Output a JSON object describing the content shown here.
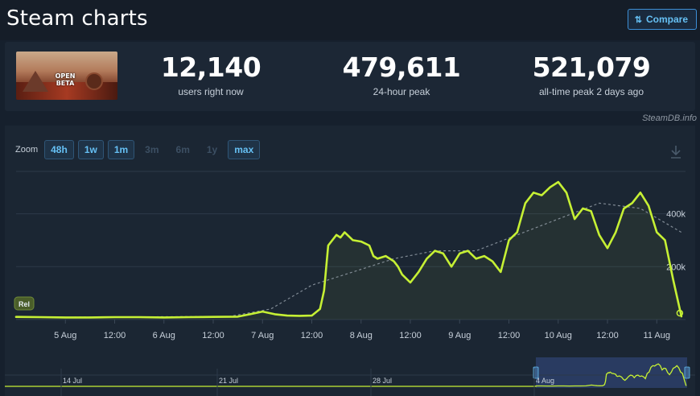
{
  "header": {
    "title": "Steam charts",
    "compare_label": "Compare"
  },
  "thumbnail": {
    "text": "OPEN BETA"
  },
  "stats": [
    {
      "value": "12,140",
      "label": "users right now"
    },
    {
      "value": "479,611",
      "label": "24-hour peak"
    },
    {
      "value": "521,079",
      "label": "all-time peak 2 days ago"
    }
  ],
  "attribution": "SteamDB.info",
  "zoom": {
    "label": "Zoom",
    "options": [
      {
        "label": "48h",
        "enabled": true
      },
      {
        "label": "1w",
        "enabled": true
      },
      {
        "label": "1m",
        "enabled": true
      },
      {
        "label": "3m",
        "enabled": false
      },
      {
        "label": "6m",
        "enabled": false
      },
      {
        "label": "1y",
        "enabled": false
      },
      {
        "label": "max",
        "enabled": true
      }
    ]
  },
  "colors": {
    "line": "#c6f034",
    "trend": "#9aa4ae",
    "grid": "#2c3949",
    "accent": "#66c0f4"
  },
  "chart_data": {
    "type": "line",
    "title": "",
    "xlabel": "",
    "ylabel": "",
    "x_ticks": [
      "5 Aug",
      "12:00",
      "6 Aug",
      "12:00",
      "7 Aug",
      "12:00",
      "8 Aug",
      "12:00",
      "9 Aug",
      "12:00",
      "10 Aug",
      "12:00",
      "11 Aug"
    ],
    "y_ticks": [
      {
        "value": 200000,
        "label": "200k"
      },
      {
        "value": 400000,
        "label": "400k"
      }
    ],
    "ylim": [
      0,
      560000
    ],
    "xlim_hours": [
      -12,
      151
    ],
    "grid": true,
    "release_label": "Rel",
    "series": [
      {
        "hours": [
          -12,
          -6,
          0,
          6,
          12,
          18,
          24,
          30,
          36,
          42,
          45,
          48,
          51,
          54,
          57,
          60,
          62,
          63,
          64,
          66,
          67,
          68,
          70,
          72,
          74,
          75,
          76,
          78,
          80,
          81,
          82,
          84,
          86,
          88,
          90,
          92,
          94,
          96,
          98,
          100,
          102,
          104,
          106,
          108,
          110,
          112,
          114,
          116,
          118,
          120,
          122,
          124,
          126,
          128,
          130,
          132,
          134,
          136,
          138,
          140,
          142,
          144,
          146,
          148,
          150
        ],
        "values": [
          10000,
          9000,
          8000,
          8000,
          9000,
          9000,
          8000,
          9000,
          10000,
          11000,
          20000,
          30000,
          20000,
          15000,
          14000,
          15000,
          40000,
          110000,
          280000,
          320000,
          310000,
          330000,
          300000,
          295000,
          280000,
          240000,
          230000,
          240000,
          220000,
          200000,
          170000,
          140000,
          180000,
          230000,
          260000,
          250000,
          200000,
          250000,
          260000,
          230000,
          240000,
          220000,
          180000,
          300000,
          330000,
          440000,
          480000,
          470000,
          500000,
          520000,
          480000,
          380000,
          420000,
          410000,
          320000,
          270000,
          330000,
          420000,
          440000,
          480000,
          430000,
          330000,
          300000,
          150000,
          12000
        ]
      },
      {
        "name": "",
        "hours": [
          -12,
          40,
          50,
          60,
          70,
          80,
          90,
          100,
          110,
          120,
          130,
          140,
          150
        ],
        "values": [
          8000,
          12000,
          40000,
          130000,
          180000,
          230000,
          260000,
          260000,
          320000,
          380000,
          440000,
          420000,
          330000
        ]
      }
    ],
    "navigator": {
      "labels": [
        "14 Jul",
        "21 Jul",
        "28 Jul",
        "4 Aug"
      ]
    }
  }
}
